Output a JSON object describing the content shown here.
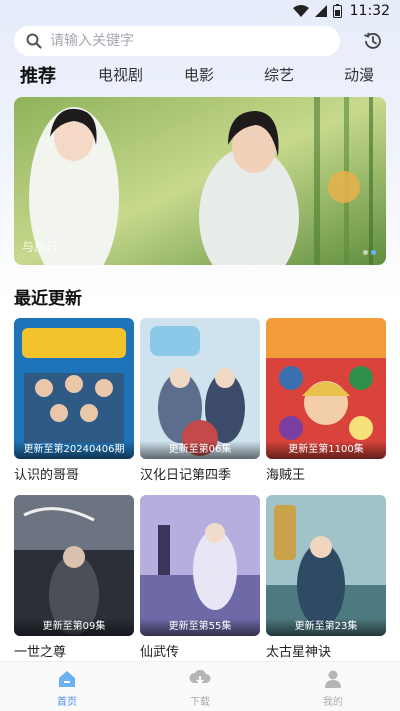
{
  "status_bar": {
    "time": "11:32"
  },
  "search": {
    "placeholder": "请输入关键字"
  },
  "tabs": [
    {
      "label": "推荐",
      "active": true
    },
    {
      "label": "电视剧",
      "active": false
    },
    {
      "label": "电影",
      "active": false
    },
    {
      "label": "综艺",
      "active": false
    },
    {
      "label": "动漫",
      "active": false
    }
  ],
  "banner": {
    "caption": "与凤行",
    "slide_count": 2,
    "active_slide": 2
  },
  "section": {
    "title": "最近更新"
  },
  "cards": [
    {
      "title": "认识的哥哥",
      "badge": "更新至第20240406期"
    },
    {
      "title": "汉化日记第四季",
      "badge": "更新至第06集"
    },
    {
      "title": "海贼王",
      "badge": "更新至第1100集"
    },
    {
      "title": "一世之尊",
      "badge": "更新至第09集"
    },
    {
      "title": "仙武传",
      "badge": "更新至第55集"
    },
    {
      "title": "太古星神诀",
      "badge": "更新至第23集"
    }
  ],
  "bottom_nav": [
    {
      "label": "首页",
      "icon": "home-icon",
      "active": true
    },
    {
      "label": "下载",
      "icon": "download-icon",
      "active": false
    },
    {
      "label": "我的",
      "icon": "user-icon",
      "active": false
    }
  ],
  "colors": {
    "accent": "#4a90e2",
    "top_background": "#e6ecfa"
  }
}
